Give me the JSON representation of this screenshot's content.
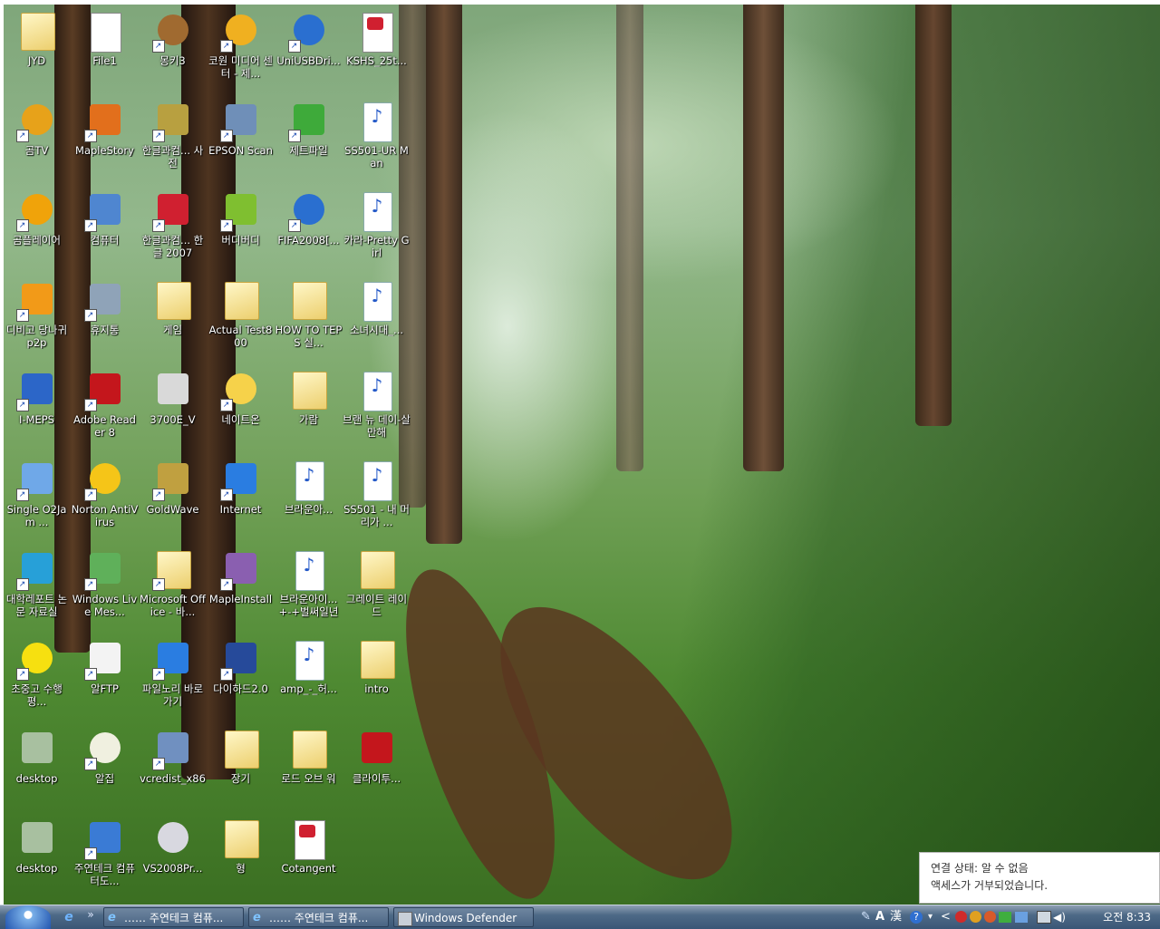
{
  "desktop": {
    "icons": [
      {
        "label": "JYD",
        "glyph": "folder-icon"
      },
      {
        "label": "File1",
        "glyph": "document-icon"
      },
      {
        "label": "몽키3",
        "glyph": "monkey-icon"
      },
      {
        "label": "코원 미디어 센터 - 제...",
        "glyph": "media-center-icon"
      },
      {
        "label": "UniUSBDri...",
        "glyph": "zip-icon"
      },
      {
        "label": "KSHS_25t...",
        "glyph": "hwp-document-icon"
      },
      {
        "label": "곰TV",
        "glyph": "gomtv-icon"
      },
      {
        "label": "MapleStory",
        "glyph": "maplestory-icon"
      },
      {
        "label": "한글과컴... 사전",
        "glyph": "dictionary-icon"
      },
      {
        "label": "EPSON Scan",
        "glyph": "scanner-icon"
      },
      {
        "label": "제트파일",
        "glyph": "zetfile-icon"
      },
      {
        "label": "SS501-UR Man",
        "glyph": "mp3-icon"
      },
      {
        "label": "곰플레이어",
        "glyph": "gomplayer-icon"
      },
      {
        "label": "컴퓨터",
        "glyph": "computer-icon"
      },
      {
        "label": "한글과컴... 한글 2007",
        "glyph": "hwp-icon"
      },
      {
        "label": "버디버디",
        "glyph": "buddybuddy-icon"
      },
      {
        "label": "FIFA2008[...",
        "glyph": "zip-icon"
      },
      {
        "label": "카라-Pretty Girl",
        "glyph": "mp3-icon"
      },
      {
        "label": "디비고 당나귀 p2p",
        "glyph": "dbgo-icon"
      },
      {
        "label": "휴지통",
        "glyph": "recycle-bin-icon"
      },
      {
        "label": "게임",
        "glyph": "folder-icon"
      },
      {
        "label": "Actual Test800",
        "glyph": "folder-icon"
      },
      {
        "label": "HOW TO TEPS 실...",
        "glyph": "folder-icon"
      },
      {
        "label": "소녀시대_...",
        "glyph": "mp3-icon"
      },
      {
        "label": "I-MEPS",
        "glyph": "headset-icon"
      },
      {
        "label": "Adobe Reader 8",
        "glyph": "adobe-reader-icon"
      },
      {
        "label": "3700E_V",
        "glyph": "setup-icon"
      },
      {
        "label": "네이트온",
        "glyph": "nateon-icon"
      },
      {
        "label": "가람",
        "glyph": "folder-icon"
      },
      {
        "label": "브랜 뉴 데이-살만해",
        "glyph": "wma-icon"
      },
      {
        "label": "Single O2Jam ...",
        "glyph": "o2jam-icon"
      },
      {
        "label": "Norton AntiVirus",
        "glyph": "norton-icon"
      },
      {
        "label": "GoldWave",
        "glyph": "goldwave-icon"
      },
      {
        "label": "Internet",
        "glyph": "internet-explorer-icon"
      },
      {
        "label": "브라운아...",
        "glyph": "mp3-icon"
      },
      {
        "label": "SS501 - 내 머리가 ...",
        "glyph": "mp3-icon"
      },
      {
        "label": "대학레포트 논문 자료실",
        "glyph": "report-icon"
      },
      {
        "label": "Windows Live Mes...",
        "glyph": "messenger-icon"
      },
      {
        "label": "Microsoft Office - 바...",
        "glyph": "office-folder-icon"
      },
      {
        "label": "MapleInstall",
        "glyph": "installer-icon"
      },
      {
        "label": "브라운아이... +-+벌써일년",
        "glyph": "mp3-icon"
      },
      {
        "label": "그레이트 레이드",
        "glyph": "folder-icon"
      },
      {
        "label": "초중고 수행평...",
        "glyph": "smiley-icon"
      },
      {
        "label": "알FTP",
        "glyph": "alftp-icon"
      },
      {
        "label": "파일노리 바로가기",
        "glyph": "internet-explorer-icon"
      },
      {
        "label": "다이하드2.0",
        "glyph": "diehard-icon"
      },
      {
        "label": "amp_-_허...",
        "glyph": "mp3-icon"
      },
      {
        "label": "intro",
        "glyph": "folder-icon"
      },
      {
        "label": "desktop",
        "glyph": "desktop-file-icon"
      },
      {
        "label": "알집",
        "glyph": "alzip-icon"
      },
      {
        "label": "vcredist_x86",
        "glyph": "installer-window-icon"
      },
      {
        "label": "장기",
        "glyph": "folder-icon"
      },
      {
        "label": "로드 오브 워",
        "glyph": "folder-icon"
      },
      {
        "label": "클라이투...",
        "glyph": "pdf-icon"
      },
      {
        "label": "desktop",
        "glyph": "desktop-file-icon"
      },
      {
        "label": "주연테크 컴퓨터도...",
        "glyph": "help-icon"
      },
      {
        "label": "VS2008Pr...",
        "glyph": "cd-icon"
      },
      {
        "label": "형",
        "glyph": "folder-icon"
      },
      {
        "label": "Cotangent",
        "glyph": "hwp-document-icon"
      }
    ]
  },
  "taskbar": {
    "quick_launch_more": "»",
    "buttons": [
      {
        "label": "…… 주연테크 컴퓨...",
        "glyph": "internet-explorer-icon"
      },
      {
        "label": "…… 주연테크 컴퓨...",
        "glyph": "internet-explorer-icon"
      },
      {
        "label": "Windows Defender",
        "glyph": "defender-icon"
      }
    ],
    "tray": {
      "ime_a": "A",
      "ime_han": "漢",
      "help": "?",
      "expand": "<",
      "clock": "오전 8:33"
    }
  },
  "notification": {
    "line1": "연결 상태: 알 수 없음",
    "line2": "액세스가 거부되었습니다."
  },
  "colors": {
    "accent": "#2459c8",
    "taskbar": "#4e6a87"
  }
}
